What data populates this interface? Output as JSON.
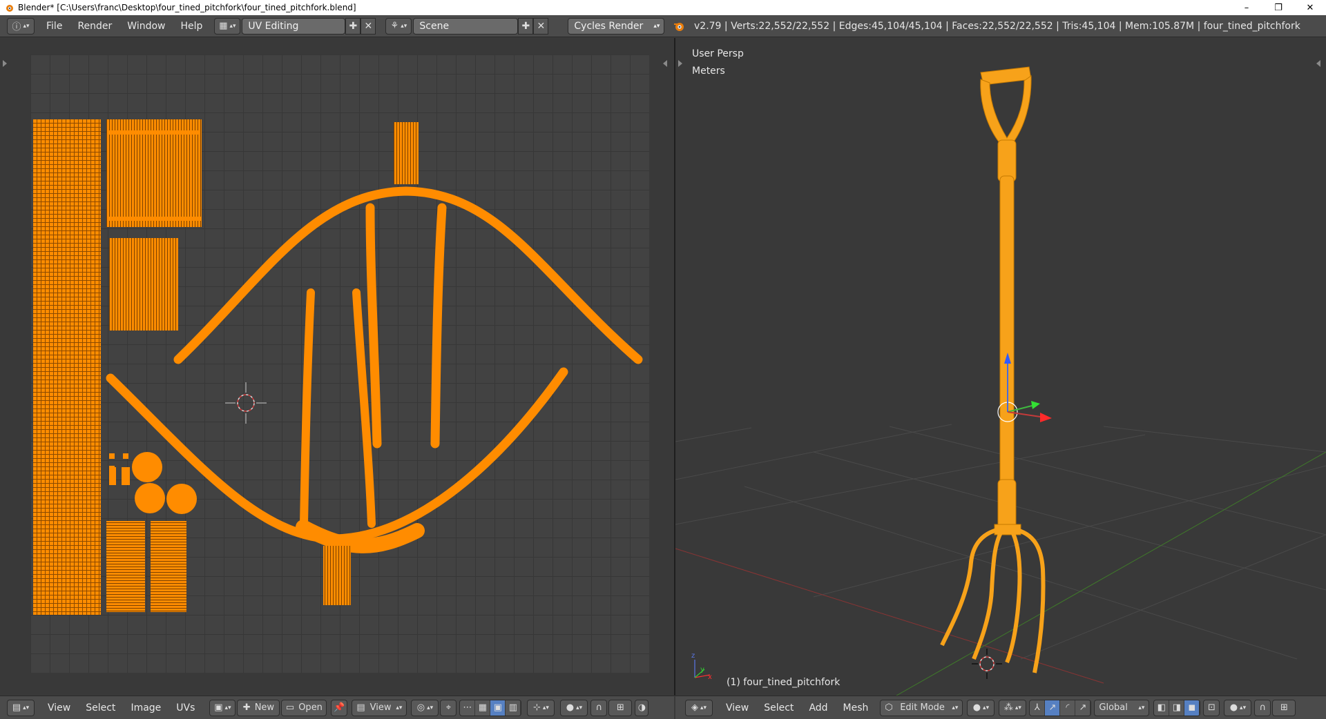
{
  "window": {
    "title": "Blender* [C:\\Users\\franc\\Desktop\\four_tined_pitchfork\\four_tined_pitchfork.blend]",
    "controls": [
      "–",
      "❐",
      "✕"
    ]
  },
  "info_header": {
    "menus": [
      "File",
      "Render",
      "Window",
      "Help"
    ],
    "screen_layout": "UV Editing",
    "scene": "Scene",
    "render_engine": "Cycles Render",
    "stats": "v2.79 | Verts:22,552/22,552 | Edges:45,104/45,104 | Faces:22,552/22,552 | Tris:45,104 | Mem:105.87M | four_tined_pitchfork"
  },
  "uv_editor": {
    "menus": [
      "View",
      "Select",
      "Image",
      "UVs"
    ],
    "new_label": "New",
    "open_label": "Open",
    "view_label": "View"
  },
  "viewport": {
    "view_name": "User Persp",
    "units": "Meters",
    "object_label": "(1) four_tined_pitchfork",
    "menus": [
      "View",
      "Select",
      "Add",
      "Mesh"
    ],
    "mode": "Edit Mode",
    "orientation": "Global"
  },
  "colors": {
    "uv_orange": "#ff8c00",
    "mesh_orange": "#f7a21a",
    "background": "#393939",
    "header": "#4b4b4b",
    "accent_blue": "#5680c2"
  }
}
